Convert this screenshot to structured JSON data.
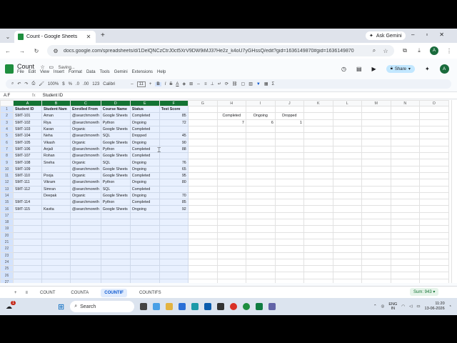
{
  "browser": {
    "tab_title": "Count - Google Sheets",
    "url": "docs.google.com/spreadsheets/d/1DelQNCzCtrJ0ct5XrV9DW9iMJ37He2z_k4oU7yGHssQ/edit?gid=1636149870#gid=1636149870",
    "ask_gemini": "Ask Gemini",
    "profile_initial": "A",
    "new_tab": "+"
  },
  "doc": {
    "title": "Count",
    "status": "Saving...",
    "menus": [
      "File",
      "Edit",
      "View",
      "Insert",
      "Format",
      "Data",
      "Tools",
      "Gemini",
      "Extensions",
      "Help"
    ],
    "share_label": "Share",
    "avatar": "A"
  },
  "format_bar": {
    "zoom": "100%",
    "currency": "$",
    "percent": "%",
    "dec_less": ".0",
    "dec_more": ".00",
    "number_fmt": "123",
    "font": "Calibri",
    "font_size": "11",
    "bold": "B",
    "sigma": "Σ"
  },
  "formula_bar": {
    "cell_ref": "A:F",
    "fx": "fx",
    "content": "Student ID"
  },
  "grid": {
    "columns": [
      "A",
      "B",
      "C",
      "D",
      "E",
      "F",
      "G",
      "H",
      "I",
      "J",
      "K",
      "L",
      "M",
      "N",
      "O"
    ],
    "selected_columns": [
      "A",
      "B",
      "C",
      "D",
      "E",
      "F"
    ],
    "headers": [
      "Student ID",
      "Student Nam",
      "Enrolled From",
      "Course Name",
      "Status",
      "Test Score"
    ],
    "rows": [
      [
        "SMT-101",
        "Aman",
        "@searchmoreth",
        "Google Sheets",
        "Completed",
        "85"
      ],
      [
        "SMT-102",
        "Riya",
        "@searchmoreth",
        "Python",
        "Ongoing",
        "72"
      ],
      [
        "SMT-103",
        "Karan",
        "Organic",
        "Google Sheets",
        "Completed",
        ""
      ],
      [
        "SMT-104",
        "Neha",
        "@searchmoreth",
        "SQL",
        "Dropped",
        "45"
      ],
      [
        "SMT-105",
        "Vikash",
        "Organic",
        "Google Sheets",
        "Ongoing",
        "90"
      ],
      [
        "SMT-106",
        "Anjali",
        "@searchmoreth",
        "Python",
        "Completed",
        "88"
      ],
      [
        "SMT-107",
        "Rohan",
        "@searchmoreth",
        "Google Sheets",
        "Completed",
        ""
      ],
      [
        "SMT-108",
        "Sneha",
        "Organic",
        "SQL",
        "Ongoing",
        "76"
      ],
      [
        "SMT-109",
        "",
        "@searchmoreth",
        "Google Sheets",
        "Ongoing",
        "65"
      ],
      [
        "SMT-110",
        "Pooja",
        "Organic",
        "Google Sheets",
        "Completed",
        "95"
      ],
      [
        "SMT-111",
        "Vikram",
        "@searchmoreth",
        "Python",
        "Ongoing",
        "80"
      ],
      [
        "SMT-112",
        "Simran",
        "@searchmoreth",
        "SQL",
        "Completed",
        ""
      ],
      [
        "",
        "Deepak",
        "Organic",
        "Google Sheets",
        "Ongoing",
        "70"
      ],
      [
        "SMT-114",
        "",
        "@searchmoreth",
        "Python",
        "Completed",
        "85"
      ],
      [
        "SMT-115",
        "Kavita",
        "@searchmoreth",
        "Google Sheets",
        "Ongoing",
        "92"
      ]
    ],
    "side_labels": [
      "Completed",
      "Ongoing",
      "Dropped"
    ],
    "side_values": [
      "7",
      "6",
      "1"
    ],
    "total_rows": 28
  },
  "sheets": {
    "add": "+",
    "list": "≡",
    "tabs": [
      "COUNT",
      "COUNTA",
      "COUNTIF",
      "COUNTIFS"
    ],
    "active": "COUNTIF",
    "sum": "Sum: 943"
  },
  "taskbar": {
    "search": "Search",
    "lang": "ENG",
    "region": "IN",
    "time": "11:20",
    "date": "13-06-2026",
    "badge": "1"
  },
  "colors": {
    "accent_green": "#137333",
    "selection": "#e8f0fe",
    "tab_active": "#0b57d0"
  }
}
